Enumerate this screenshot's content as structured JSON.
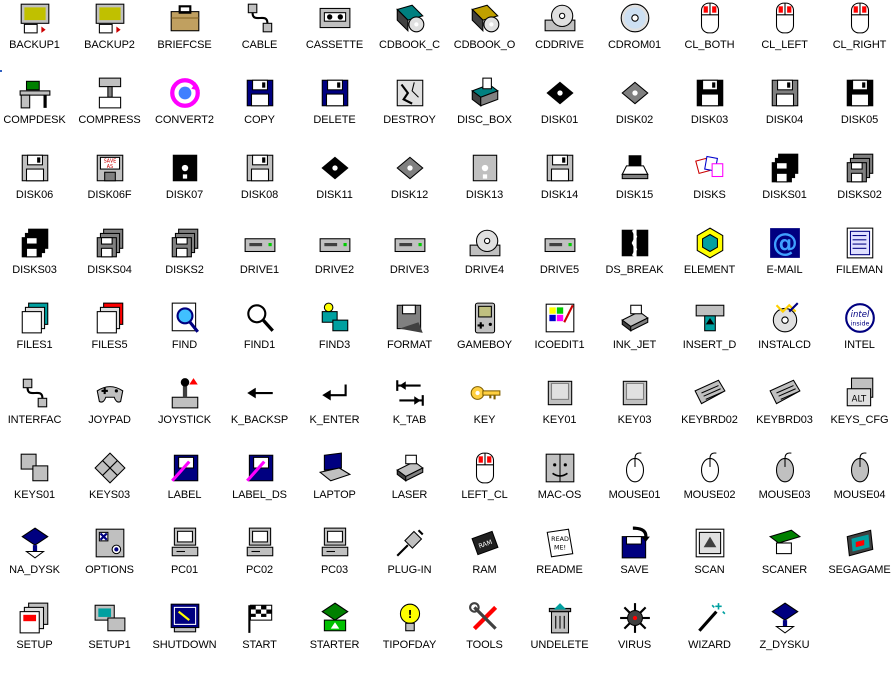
{
  "icons": [
    {
      "label": "BACKUP1",
      "icon": "backup-icon",
      "color": "#c0c000"
    },
    {
      "label": "BACKUP2",
      "icon": "backup-icon",
      "color": "#c0c000"
    },
    {
      "label": "BRIEFCSE",
      "icon": "briefcase-icon",
      "color": "#a08040"
    },
    {
      "label": "CABLE",
      "icon": "cable-icon",
      "color": "#404040"
    },
    {
      "label": "CASSETTE",
      "icon": "cassette-icon",
      "color": "#808080"
    },
    {
      "label": "CDBOOK_C",
      "icon": "cdbook-icon",
      "color": "#008080"
    },
    {
      "label": "CDBOOK_O",
      "icon": "cdbook-icon",
      "color": "#c0a000"
    },
    {
      "label": "CDDRIVE",
      "icon": "cddrive-icon",
      "color": "#c0c0c0"
    },
    {
      "label": "CDROM01",
      "icon": "cd-icon",
      "color": "#c0c0c0"
    },
    {
      "label": "CL_BOTH",
      "icon": "mouse-click-icon",
      "color": "#ff0000"
    },
    {
      "label": "CL_LEFT",
      "icon": "mouse-click-icon",
      "color": "#ff0000"
    },
    {
      "label": "CL_RIGHT",
      "icon": "mouse-click-icon",
      "color": "#ff0000"
    },
    {
      "label": "COMPDESK",
      "icon": "desk-icon",
      "color": "#008000"
    },
    {
      "label": "COMPRESS",
      "icon": "compress-icon",
      "color": "#808080"
    },
    {
      "label": "CONVERT2",
      "icon": "convert-icon",
      "color": "#ff00ff"
    },
    {
      "label": "COPY",
      "icon": "floppy-icon",
      "color": "#000080"
    },
    {
      "label": "DELETE",
      "icon": "floppy-icon",
      "color": "#000080"
    },
    {
      "label": "DESTROY",
      "icon": "destroy-icon",
      "color": "#808080"
    },
    {
      "label": "DISC_BOX",
      "icon": "disc-box-icon",
      "color": "#008080"
    },
    {
      "label": "DISK01",
      "icon": "diskette-flat-icon",
      "color": "#000000"
    },
    {
      "label": "DISK02",
      "icon": "diskette-flat-icon",
      "color": "#808080"
    },
    {
      "label": "DISK03",
      "icon": "floppy-icon",
      "color": "#000000"
    },
    {
      "label": "DISK04",
      "icon": "floppy-icon",
      "color": "#808080"
    },
    {
      "label": "DISK05",
      "icon": "floppy-icon",
      "color": "#000000"
    },
    {
      "label": "DISK06",
      "icon": "floppy-icon",
      "color": "#c0c0c0"
    },
    {
      "label": "DISK06F",
      "icon": "floppy-save-icon",
      "color": "#c0c0c0"
    },
    {
      "label": "DISK07",
      "icon": "diskette-icon",
      "color": "#000000"
    },
    {
      "label": "DISK08",
      "icon": "floppy-icon",
      "color": "#c0c0c0"
    },
    {
      "label": "DISK11",
      "icon": "diskette-flat-icon",
      "color": "#000000"
    },
    {
      "label": "DISK12",
      "icon": "diskette-flat-icon",
      "color": "#808080"
    },
    {
      "label": "DISK13",
      "icon": "diskette-icon",
      "color": "#c0c0c0"
    },
    {
      "label": "DISK14",
      "icon": "floppy-icon",
      "color": "#c0c0c0"
    },
    {
      "label": "DISK15",
      "icon": "disk-drive-icon",
      "color": "#000000"
    },
    {
      "label": "DISKS",
      "icon": "disks-icon",
      "color": "#ff00ff"
    },
    {
      "label": "DISKS01",
      "icon": "disk-stack-icon",
      "color": "#000000"
    },
    {
      "label": "DISKS02",
      "icon": "disk-stack-icon",
      "color": "#808080"
    },
    {
      "label": "DISKS03",
      "icon": "disk-stack-icon",
      "color": "#000000"
    },
    {
      "label": "DISKS04",
      "icon": "disk-stack-icon",
      "color": "#808080"
    },
    {
      "label": "DISKS2",
      "icon": "disk-stack-icon",
      "color": "#808080"
    },
    {
      "label": "DRIVE1",
      "icon": "drive-icon",
      "color": "#808080"
    },
    {
      "label": "DRIVE2",
      "icon": "drive-icon",
      "color": "#808080"
    },
    {
      "label": "DRIVE3",
      "icon": "drive-icon",
      "color": "#808080"
    },
    {
      "label": "DRIVE4",
      "icon": "cd-drive-icon",
      "color": "#808080"
    },
    {
      "label": "DRIVE5",
      "icon": "drive-icon",
      "color": "#808080"
    },
    {
      "label": "DS_BREAK",
      "icon": "broken-disk-icon",
      "color": "#000000"
    },
    {
      "label": "ELEMENT",
      "icon": "element-icon",
      "color": "#00a0a0"
    },
    {
      "label": "E-MAIL",
      "icon": "email-icon",
      "color": "#0000c0"
    },
    {
      "label": "FILEMAN",
      "icon": "fileman-icon",
      "color": "#000080"
    },
    {
      "label": "FILES1",
      "icon": "files-icon",
      "color": "#00a0a0"
    },
    {
      "label": "FILES5",
      "icon": "files-icon",
      "color": "#ff0000"
    },
    {
      "label": "FIND",
      "icon": "find-icon",
      "color": "#000080"
    },
    {
      "label": "FIND1",
      "icon": "magnifier-icon",
      "color": "#000000"
    },
    {
      "label": "FIND3",
      "icon": "find-folders-icon",
      "color": "#00a0a0"
    },
    {
      "label": "FORMAT",
      "icon": "format-icon",
      "color": "#808080"
    },
    {
      "label": "GAMEBOY",
      "icon": "gameboy-icon",
      "color": "#808080"
    },
    {
      "label": "ICOEDIT1",
      "icon": "icon-editor-icon",
      "color": "#ff00ff"
    },
    {
      "label": "INK_JET",
      "icon": "printer-icon",
      "color": "#808080"
    },
    {
      "label": "INSERT_D",
      "icon": "insert-disk-icon",
      "color": "#00a0a0"
    },
    {
      "label": "INSTALCD",
      "icon": "install-cd-icon",
      "color": "#000080"
    },
    {
      "label": "INTEL",
      "icon": "intel-inside-icon",
      "color": "#000080"
    },
    {
      "label": "INTERFAC",
      "icon": "cable-icon",
      "color": "#404040"
    },
    {
      "label": "JOYPAD",
      "icon": "joypad-icon",
      "color": "#808080"
    },
    {
      "label": "JOYSTICK",
      "icon": "joystick-icon",
      "color": "#ff0000"
    },
    {
      "label": "K_BACKSP",
      "icon": "arrow-left-icon",
      "color": "#000000"
    },
    {
      "label": "K_ENTER",
      "icon": "enter-arrow-icon",
      "color": "#000000"
    },
    {
      "label": "K_TAB",
      "icon": "tab-arrows-icon",
      "color": "#000000"
    },
    {
      "label": "KEY",
      "icon": "key-icon",
      "color": "#c0a000"
    },
    {
      "label": "KEY01",
      "icon": "keycap-icon",
      "color": "#c0c0c0"
    },
    {
      "label": "KEY03",
      "icon": "keycap-icon",
      "color": "#c0c0c0"
    },
    {
      "label": "KEYBRD02",
      "icon": "keyboard-icon",
      "color": "#808080"
    },
    {
      "label": "KEYBRD03",
      "icon": "keyboard-icon",
      "color": "#808080"
    },
    {
      "label": "KEYS_CFG",
      "icon": "keys-cfg-icon",
      "color": "#c0c0c0"
    },
    {
      "label": "KEYS01",
      "icon": "keycaps-icon",
      "color": "#c0c0c0"
    },
    {
      "label": "KEYS03",
      "icon": "arrow-keys-icon",
      "color": "#c0c0c0"
    },
    {
      "label": "LABEL",
      "icon": "label-icon",
      "color": "#000080"
    },
    {
      "label": "LABEL_DS",
      "icon": "label-icon",
      "color": "#000080"
    },
    {
      "label": "LAPTOP",
      "icon": "laptop-icon",
      "color": "#000080"
    },
    {
      "label": "LASER",
      "icon": "laser-printer-icon",
      "color": "#808080"
    },
    {
      "label": "LEFT_CL",
      "icon": "mouse-click-icon",
      "color": "#ff0000"
    },
    {
      "label": "MAC-OS",
      "icon": "mac-os-icon",
      "color": "#808080"
    },
    {
      "label": "MOUSE01",
      "icon": "mouse-icon",
      "color": "#ffffff"
    },
    {
      "label": "MOUSE02",
      "icon": "mouse-icon",
      "color": "#ffffff"
    },
    {
      "label": "MOUSE03",
      "icon": "mouse-icon",
      "color": "#c0c0c0"
    },
    {
      "label": "MOUSE04",
      "icon": "mouse-icon",
      "color": "#c0c0c0"
    },
    {
      "label": "NA_DYSK",
      "icon": "disk-tray-icon",
      "color": "#000080"
    },
    {
      "label": "OPTIONS",
      "icon": "options-icon",
      "color": "#000080"
    },
    {
      "label": "PC01",
      "icon": "pc-icon",
      "color": "#c0c0c0"
    },
    {
      "label": "PC02",
      "icon": "pc-icon",
      "color": "#c0c0c0"
    },
    {
      "label": "PC03",
      "icon": "pc-icon",
      "color": "#c0c0c0"
    },
    {
      "label": "PLUG-IN",
      "icon": "plug-icon",
      "color": "#808080"
    },
    {
      "label": "RAM",
      "icon": "ram-chip-icon",
      "color": "#000000"
    },
    {
      "label": "README",
      "icon": "readme-icon",
      "color": "#808080"
    },
    {
      "label": "SAVE",
      "icon": "save-icon",
      "color": "#000080"
    },
    {
      "label": "SCAN",
      "icon": "scan-icon",
      "color": "#808080"
    },
    {
      "label": "SCANER",
      "icon": "scanner-icon",
      "color": "#008000"
    },
    {
      "label": "SEGAGAME",
      "icon": "sega-cartridge-icon",
      "color": "#404040"
    },
    {
      "label": "SETUP",
      "icon": "setup-icon",
      "color": "#ff0000"
    },
    {
      "label": "SETUP1",
      "icon": "setup-pc-icon",
      "color": "#00a0a0"
    },
    {
      "label": "SHUTDOWN",
      "icon": "shutdown-icon",
      "color": "#000080"
    },
    {
      "label": "START",
      "icon": "checkered-flag-icon",
      "color": "#000000"
    },
    {
      "label": "STARTER",
      "icon": "starter-icon",
      "color": "#008000"
    },
    {
      "label": "TIPOFDAY",
      "icon": "lightbulb-icon",
      "color": "#ffff00"
    },
    {
      "label": "TOOLS",
      "icon": "tools-icon",
      "color": "#ff0000"
    },
    {
      "label": "UNDELETE",
      "icon": "recycle-bin-icon",
      "color": "#00a0a0"
    },
    {
      "label": "VIRUS",
      "icon": "virus-icon",
      "color": "#ff0000"
    },
    {
      "label": "WIZARD",
      "icon": "wizard-wand-icon",
      "color": "#00a0a0"
    },
    {
      "label": "Z_DYSKU",
      "icon": "disk-tray-icon",
      "color": "#000080"
    }
  ]
}
